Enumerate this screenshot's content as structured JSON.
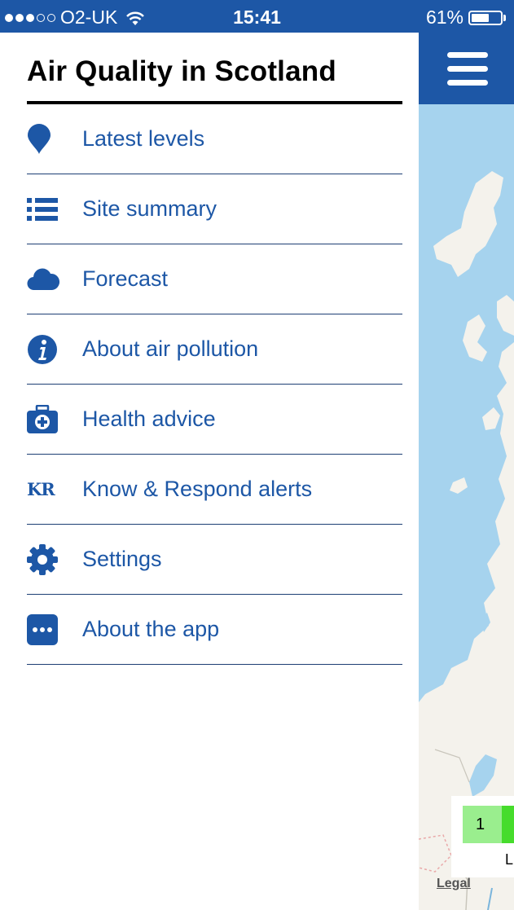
{
  "status_bar": {
    "carrier": "O2-UK",
    "time": "15:41",
    "battery": "61%",
    "battery_level": 0.61,
    "signal_bars": 3
  },
  "drawer": {
    "title": "Air Quality in Scotland",
    "items": [
      {
        "label": "Latest levels",
        "icon": "map-pin-icon"
      },
      {
        "label": "Site summary",
        "icon": "list-icon"
      },
      {
        "label": "Forecast",
        "icon": "cloud-icon"
      },
      {
        "label": "About air pollution",
        "icon": "info-icon"
      },
      {
        "label": "Health advice",
        "icon": "first-aid-kit-icon"
      },
      {
        "label": "Know & Respond alerts",
        "icon": "kr-logo-icon",
        "icon_text": "KR"
      },
      {
        "label": "Settings",
        "icon": "gear-icon"
      },
      {
        "label": "About the app",
        "icon": "ellipsis-icon"
      }
    ]
  },
  "map": {
    "legend_value": "1",
    "legend_letter": "L",
    "legal_link": "Legal"
  },
  "colors": {
    "brand_blue": "#1d57a6",
    "water": "#a6d3ee",
    "land": "#f4f2ec",
    "legend_low": "#9aee8e"
  }
}
